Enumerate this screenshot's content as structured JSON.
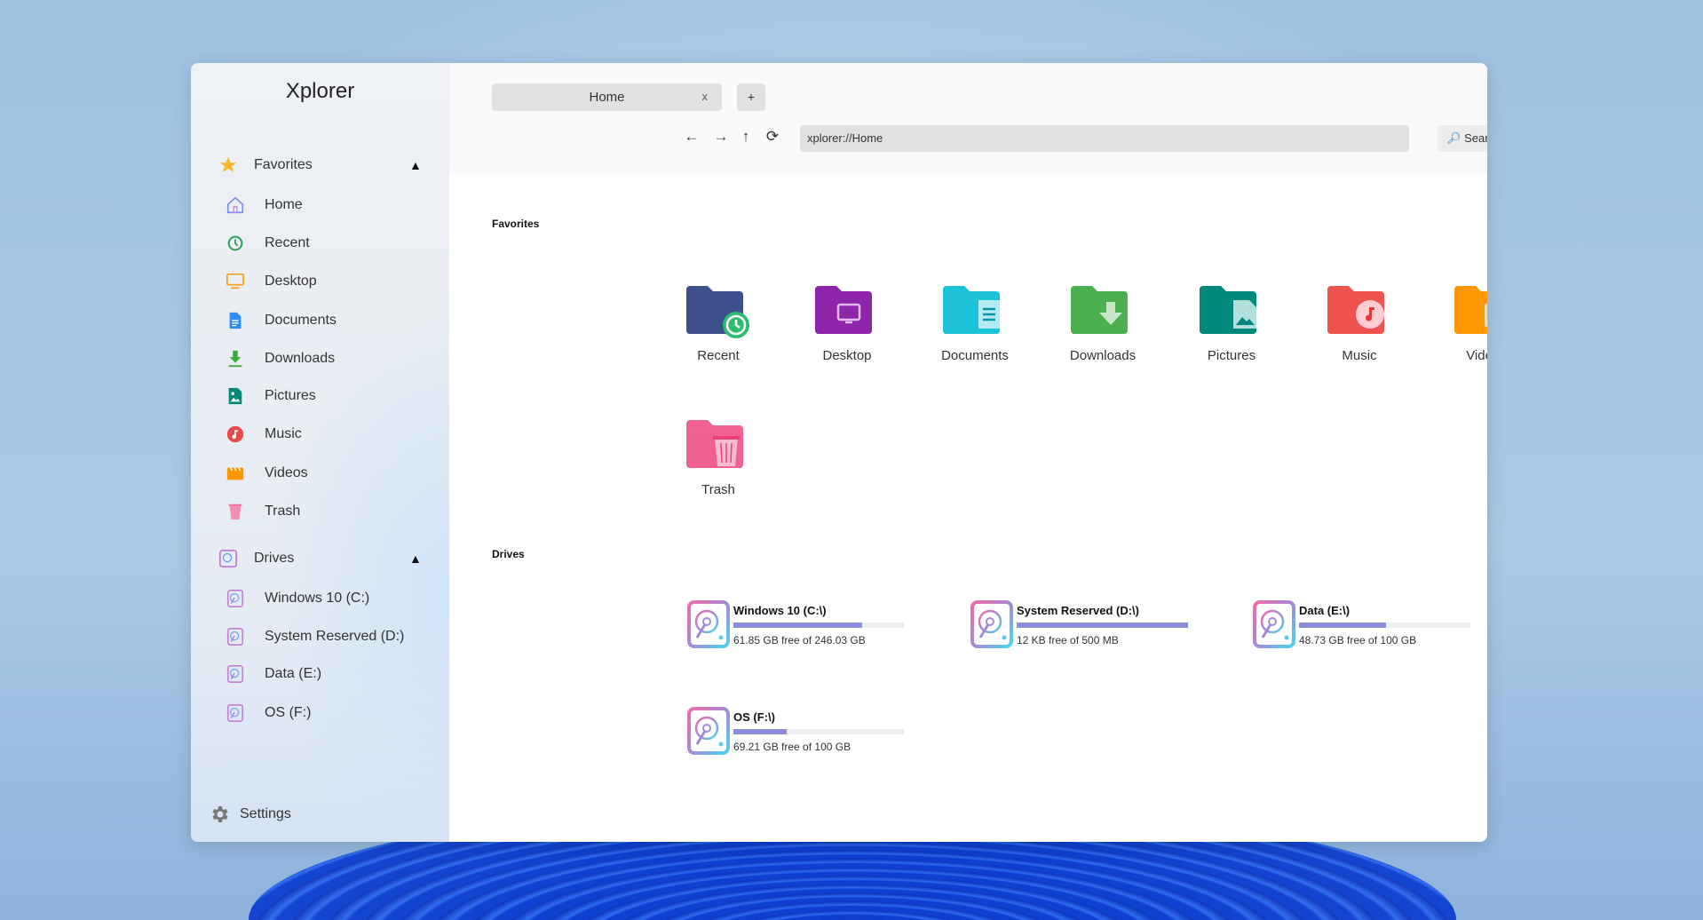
{
  "app": {
    "title": "Xplorer"
  },
  "sidebar": {
    "favorites_label": "Favorites",
    "items": [
      {
        "label": "Home",
        "icon": "home-icon"
      },
      {
        "label": "Recent",
        "icon": "recent-icon"
      },
      {
        "label": "Desktop",
        "icon": "desktop-icon"
      },
      {
        "label": "Documents",
        "icon": "documents-icon"
      },
      {
        "label": "Downloads",
        "icon": "downloads-icon"
      },
      {
        "label": "Pictures",
        "icon": "pictures-icon"
      },
      {
        "label": "Music",
        "icon": "music-icon"
      },
      {
        "label": "Videos",
        "icon": "videos-icon"
      },
      {
        "label": "Trash",
        "icon": "trash-icon"
      }
    ],
    "drives_label": "Drives",
    "drives": [
      {
        "label": "Windows 10 (C:)"
      },
      {
        "label": "System Reserved (D:)"
      },
      {
        "label": "Data (E:)"
      },
      {
        "label": "OS (F:)"
      }
    ],
    "settings_label": "Settings"
  },
  "tabs": [
    {
      "label": "Home",
      "close": "x"
    }
  ],
  "new_tab_label": "+",
  "toolbar": {
    "back": "←",
    "forward": "→",
    "up": "↑",
    "refresh": "⟳",
    "address": "xplorer://Home",
    "search_placeholder": "Search"
  },
  "window_controls": {
    "minimize_color": "#fbd01e",
    "maximize_color": "#00c853",
    "close_color": "#ff5252"
  },
  "main": {
    "favorites_heading": "Favorites",
    "favorites": [
      {
        "label": "Recent",
        "color": "#3d4f8c",
        "icon": "recent-folder-icon"
      },
      {
        "label": "Desktop",
        "color": "#8e24aa",
        "icon": "desktop-folder-icon"
      },
      {
        "label": "Documents",
        "color": "#1cc3d8",
        "icon": "documents-folder-icon"
      },
      {
        "label": "Downloads",
        "color": "#4caf50",
        "icon": "downloads-folder-icon"
      },
      {
        "label": "Pictures",
        "color": "#00897b",
        "icon": "pictures-folder-icon"
      },
      {
        "label": "Music",
        "color": "#ef5350",
        "icon": "music-folder-icon"
      },
      {
        "label": "Videos",
        "color": "#ff9800",
        "icon": "videos-folder-icon"
      },
      {
        "label": "Trash",
        "color": "#f06292",
        "icon": "trash-folder-icon"
      }
    ],
    "drives_heading": "Drives",
    "drives": [
      {
        "name": "Windows 10 (C:\\)",
        "free": "61.85 GB free of 246.03 GB",
        "used_percent": 75
      },
      {
        "name": "System Reserved (D:\\)",
        "free": "12 KB free of 500 MB",
        "used_percent": 100
      },
      {
        "name": "Data (E:\\)",
        "free": "48.73 GB free of 100 GB",
        "used_percent": 51
      },
      {
        "name": "OS (F:\\)",
        "free": "69.21 GB free of 100 GB",
        "used_percent": 31
      }
    ]
  }
}
